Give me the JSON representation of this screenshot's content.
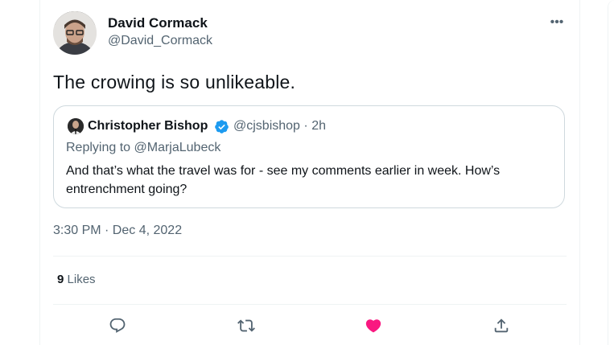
{
  "tweet": {
    "author_name": "David Cormack",
    "author_handle": "@David_Cormack",
    "text": "The crowing is so unlikeable.",
    "timestamp": "3:30 PM · Dec 4, 2022",
    "likes_count": "9",
    "likes_label": "Likes",
    "more_glyph": "•••"
  },
  "quote": {
    "author_name": "Christopher Bishop",
    "author_handle": "@cjsbishop",
    "separator": "·",
    "time": "2h",
    "reply_prefix": "Replying to",
    "reply_handle": "@MarjaLubeck",
    "text": "And that’s what the travel was for - see my comments earlier in week. How’s entrenchment going?"
  },
  "actions": [
    {
      "icon": "reply-icon"
    },
    {
      "icon": "retweet-icon"
    },
    {
      "icon": "heart-icon",
      "active": true,
      "color": "#f91880"
    },
    {
      "icon": "share-icon"
    }
  ],
  "colors": {
    "text_primary": "#0f1419",
    "text_secondary": "#536471",
    "verified": "#1d9bf0",
    "like_active": "#f91880",
    "border": "#cfd9de"
  }
}
